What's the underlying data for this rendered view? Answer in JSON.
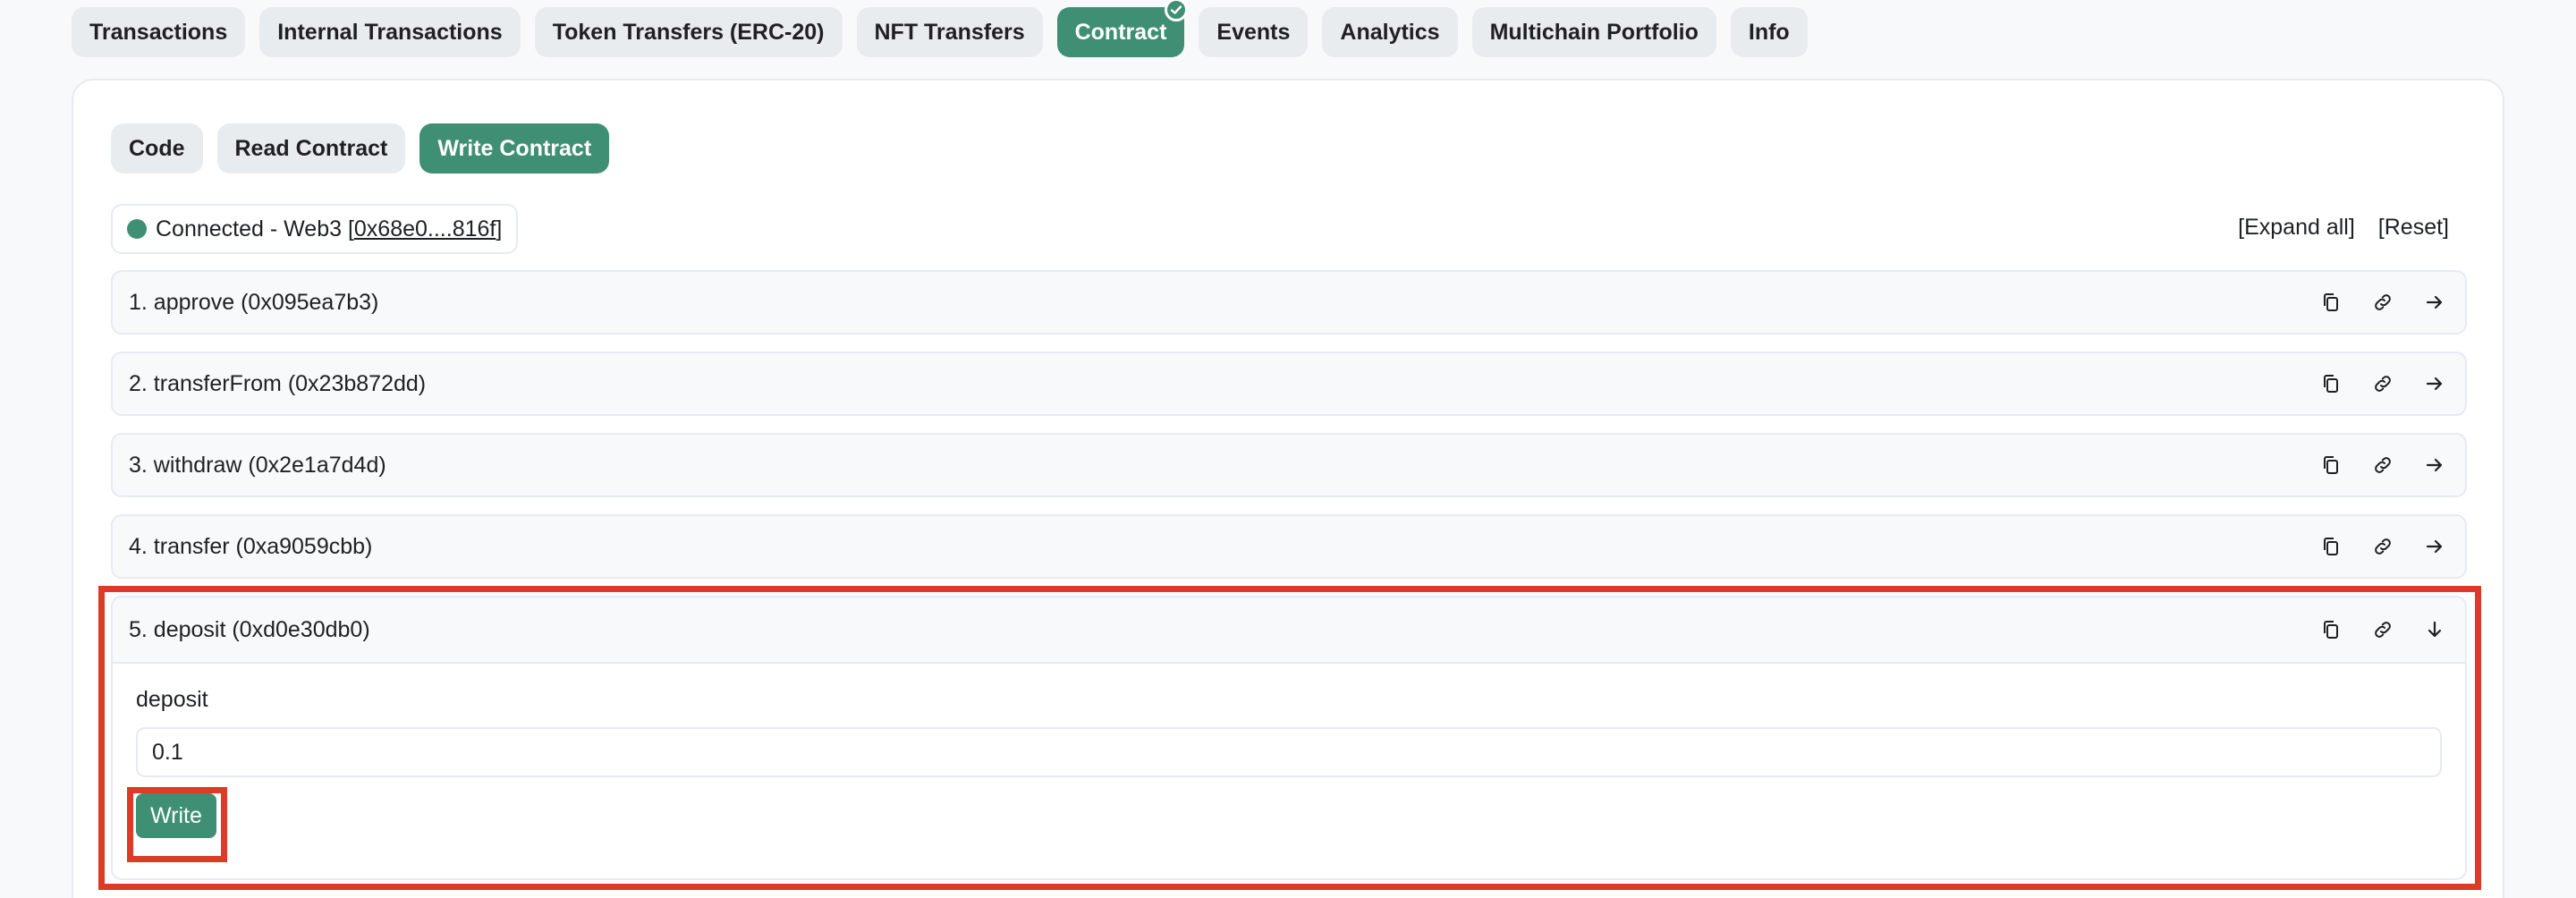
{
  "top_tabs": [
    {
      "label": "Transactions"
    },
    {
      "label": "Internal Transactions"
    },
    {
      "label": "Token Transfers (ERC-20)"
    },
    {
      "label": "NFT Transfers"
    },
    {
      "label": "Contract"
    },
    {
      "label": "Events"
    },
    {
      "label": "Analytics"
    },
    {
      "label": "Multichain Portfolio"
    },
    {
      "label": "Info"
    }
  ],
  "sub_tabs": [
    {
      "label": "Code"
    },
    {
      "label": "Read Contract"
    },
    {
      "label": "Write Contract"
    }
  ],
  "connection": {
    "status": "Connected - Web3 [",
    "address": "0x68e0....816f",
    "suffix": "]"
  },
  "actions": {
    "expand_all": "[Expand all]",
    "reset": "[Reset]"
  },
  "functions": [
    {
      "label": "1. approve (0x095ea7b3)"
    },
    {
      "label": "2. transferFrom (0x23b872dd)"
    },
    {
      "label": "3. withdraw (0x2e1a7d4d)"
    },
    {
      "label": "4. transfer (0xa9059cbb)"
    },
    {
      "label": "5. deposit (0xd0e30db0)"
    }
  ],
  "deposit_form": {
    "field_label": "deposit",
    "value": "0.1",
    "button": "Write"
  },
  "colors": {
    "accent": "#3f8f75",
    "highlight": "#dc3b26"
  },
  "icons": [
    "copy-icon",
    "link-icon",
    "arrow-right-icon",
    "arrow-down-icon",
    "check-icon"
  ]
}
